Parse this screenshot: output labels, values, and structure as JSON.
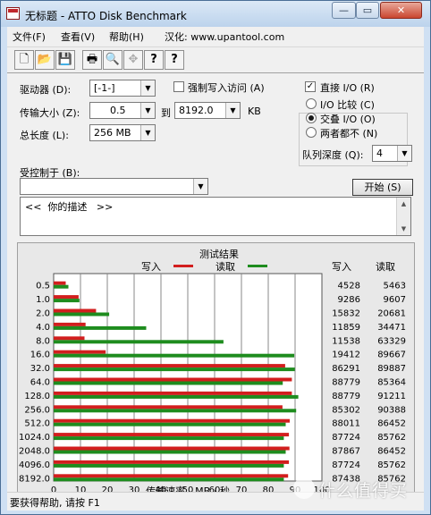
{
  "window": {
    "title": "无标题 - ATTO Disk Benchmark",
    "min_glyph": "—",
    "max_glyph": "▭",
    "close_glyph": "✕"
  },
  "menu": [
    "文件(F)",
    "查看(V)",
    "帮助(H)",
    "汉化: www.upantool.com"
  ],
  "toolbar": [
    {
      "icon": "new-document-icon",
      "glyph": "🗋"
    },
    {
      "icon": "open-folder-icon",
      "glyph": "📂"
    },
    {
      "icon": "save-disk-icon",
      "glyph": "💾"
    },
    {
      "icon": "print-icon",
      "glyph": "🖶"
    },
    {
      "icon": "print-preview-icon",
      "glyph": "🔍"
    },
    {
      "icon": "move-arrows-icon",
      "glyph": "✥"
    },
    {
      "icon": "help-icon",
      "glyph": "?"
    },
    {
      "icon": "context-help-icon",
      "glyph": "?"
    }
  ],
  "settings": {
    "drive_label": "驱动器 (D):",
    "drive_value": "[-1-]",
    "force_write_label": "强制写入访问 (A)",
    "force_write_checked": false,
    "transfer_label": "传输大小 (Z):",
    "transfer_from": "0.5",
    "to_label": "到",
    "transfer_to": "8192.0",
    "kb_label": "KB",
    "total_label": "总长度 (L):",
    "total_value": "256 MB",
    "direct_io_label": "直接 I/O (R)",
    "direct_io_checked": true,
    "mode_options": [
      {
        "label": "I/O 比较 (C)",
        "selected": false
      },
      {
        "label": "交叠 I/O (O)",
        "selected": true
      },
      {
        "label": "两者都不 (N)",
        "selected": false
      }
    ],
    "queue_label": "队列深度 (Q):",
    "queue_value": "4",
    "controlled_label": "受控制于 (B):",
    "controlled_value": "",
    "start_button": "开始 (S)",
    "description": "<<  你的描述   >>"
  },
  "results": {
    "title": "测试结果",
    "write_label": "写入",
    "read_label": "读取",
    "write_color": "#d21e1e",
    "read_color": "#1e8c1e",
    "col_write_header": "写入",
    "col_read_header": "读取"
  },
  "chart_data": {
    "type": "bar",
    "orientation": "horizontal",
    "title": "测试结果",
    "xlabel": "传输速率 - MB / 秒",
    "xlim": [
      0,
      100
    ],
    "xticks": [
      "0",
      "10",
      "20",
      "30",
      "40",
      "50",
      "60",
      "70",
      "80",
      "90",
      "100"
    ],
    "categories": [
      "0.5",
      "1.0",
      "2.0",
      "4.0",
      "8.0",
      "16.0",
      "32.0",
      "64.0",
      "128.0",
      "256.0",
      "512.0",
      "1024.0",
      "2048.0",
      "4096.0",
      "8192.0"
    ],
    "series": [
      {
        "name": "写入",
        "color": "#d21e1e",
        "values": [
          4.5,
          9.3,
          15.8,
          11.9,
          11.5,
          19.4,
          86.3,
          88.8,
          88.8,
          85.3,
          88.0,
          87.7,
          87.9,
          87.7,
          87.4
        ],
        "labels": [
          "4528",
          "9286",
          "15832",
          "11859",
          "11538",
          "19412",
          "86291",
          "88779",
          "88779",
          "85302",
          "88011",
          "87724",
          "87867",
          "87724",
          "87438"
        ]
      },
      {
        "name": "读取",
        "color": "#1e8c1e",
        "values": [
          5.5,
          9.6,
          20.7,
          34.5,
          63.3,
          89.7,
          89.9,
          85.4,
          91.2,
          90.4,
          86.5,
          85.8,
          86.5,
          85.8,
          85.8
        ],
        "labels": [
          "5463",
          "9607",
          "20681",
          "34471",
          "63329",
          "89667",
          "89887",
          "85364",
          "91211",
          "90388",
          "86452",
          "85762",
          "86452",
          "85762",
          "85762"
        ]
      }
    ],
    "grid": true,
    "legend": "top"
  },
  "status": "要获得帮助, 请按 F1",
  "watermark": "什么值得买"
}
